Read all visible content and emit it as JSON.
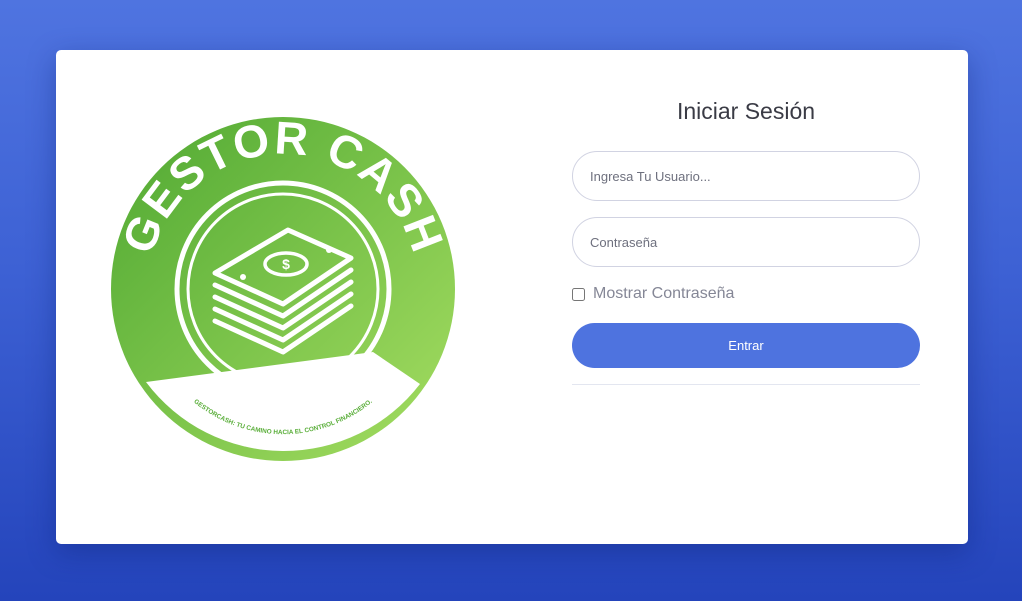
{
  "logo": {
    "brand_text": "GESTOR CASH",
    "tagline": "GESTORCASH: TU CAMINO HACIA EL CONTROL FINANCIERO."
  },
  "login": {
    "title": "Iniciar Sesión",
    "username_placeholder": "Ingresa Tu Usuario...",
    "password_placeholder": "Contraseña",
    "show_password_label": "Mostrar Contraseña",
    "submit_label": "Entrar"
  },
  "colors": {
    "background": "#4e73df",
    "button": "#4e73df",
    "logo_green_dark": "#5aae3a",
    "logo_green_light": "#9ddc5c"
  }
}
